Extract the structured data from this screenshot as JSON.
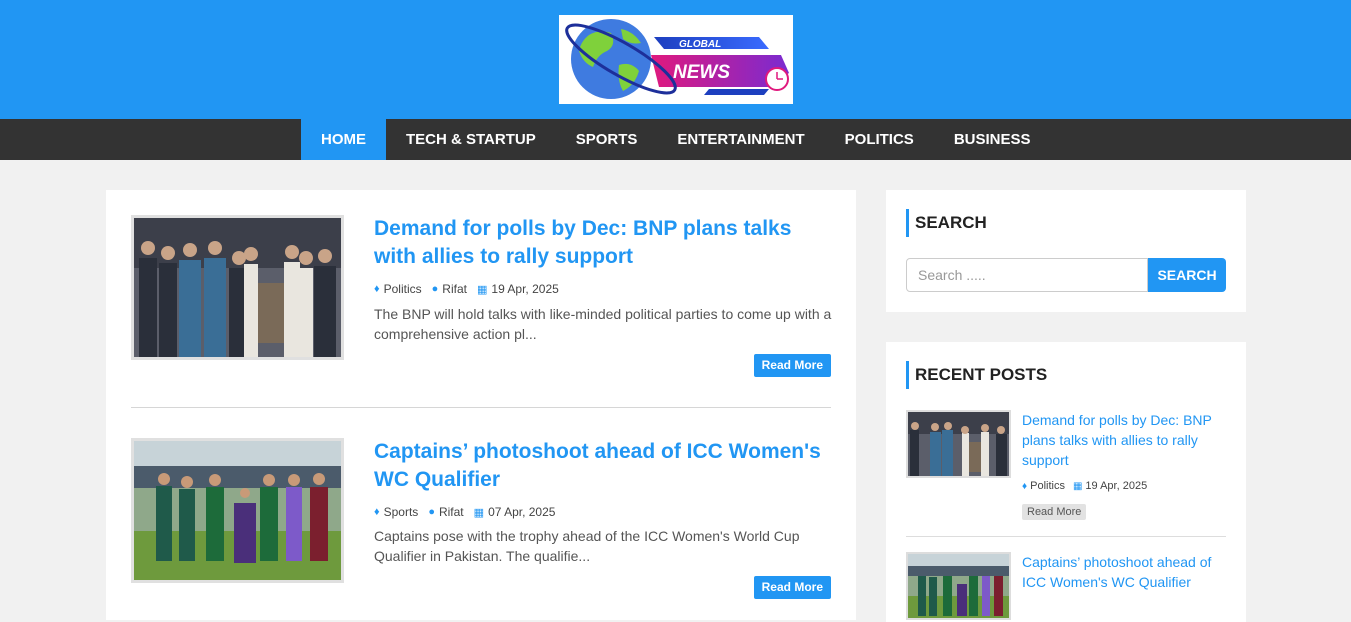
{
  "logo": {
    "line1": "GLOBAL",
    "line2": "NEWS"
  },
  "nav": {
    "items": [
      {
        "label": "HOME"
      },
      {
        "label": "TECH & STARTUP"
      },
      {
        "label": "SPORTS"
      },
      {
        "label": "ENTERTAINMENT"
      },
      {
        "label": "POLITICS"
      },
      {
        "label": "BUSINESS"
      }
    ]
  },
  "posts": [
    {
      "title": "Demand for polls by Dec: BNP plans talks with allies to rally support",
      "category": "Politics",
      "author": "Rifat",
      "date": "19 Apr, 2025",
      "excerpt": "The BNP will hold talks with like-minded political parties to come up with a comprehensive action pl...",
      "read_more": "Read More"
    },
    {
      "title": "Captains’ photoshoot ahead of ICC Women's WC Qualifier",
      "category": "Sports",
      "author": "Rifat",
      "date": "07 Apr, 2025",
      "excerpt": "Captains pose with the trophy ahead of the ICC Women's World Cup Qualifier in Pakistan. The qualifie...",
      "read_more": "Read More"
    }
  ],
  "sidebar": {
    "search": {
      "title": "SEARCH",
      "placeholder": "Search .....",
      "button": "SEARCH"
    },
    "recent": {
      "title": "RECENT POSTS",
      "items": [
        {
          "title": "Demand for polls by Dec: BNP plans talks with allies to rally support",
          "category": "Politics",
          "date": "19 Apr, 2025",
          "read_more": "Read More"
        },
        {
          "title": "Captains’ photoshoot ahead of ICC Women's WC Qualifier"
        }
      ]
    }
  },
  "colors": {
    "accent": "#2196f3",
    "nav_bg": "#333333",
    "page_bg": "#f1f1f1"
  },
  "icons": {
    "category": "tag-icon",
    "author": "user-icon",
    "date": "calendar-icon"
  }
}
